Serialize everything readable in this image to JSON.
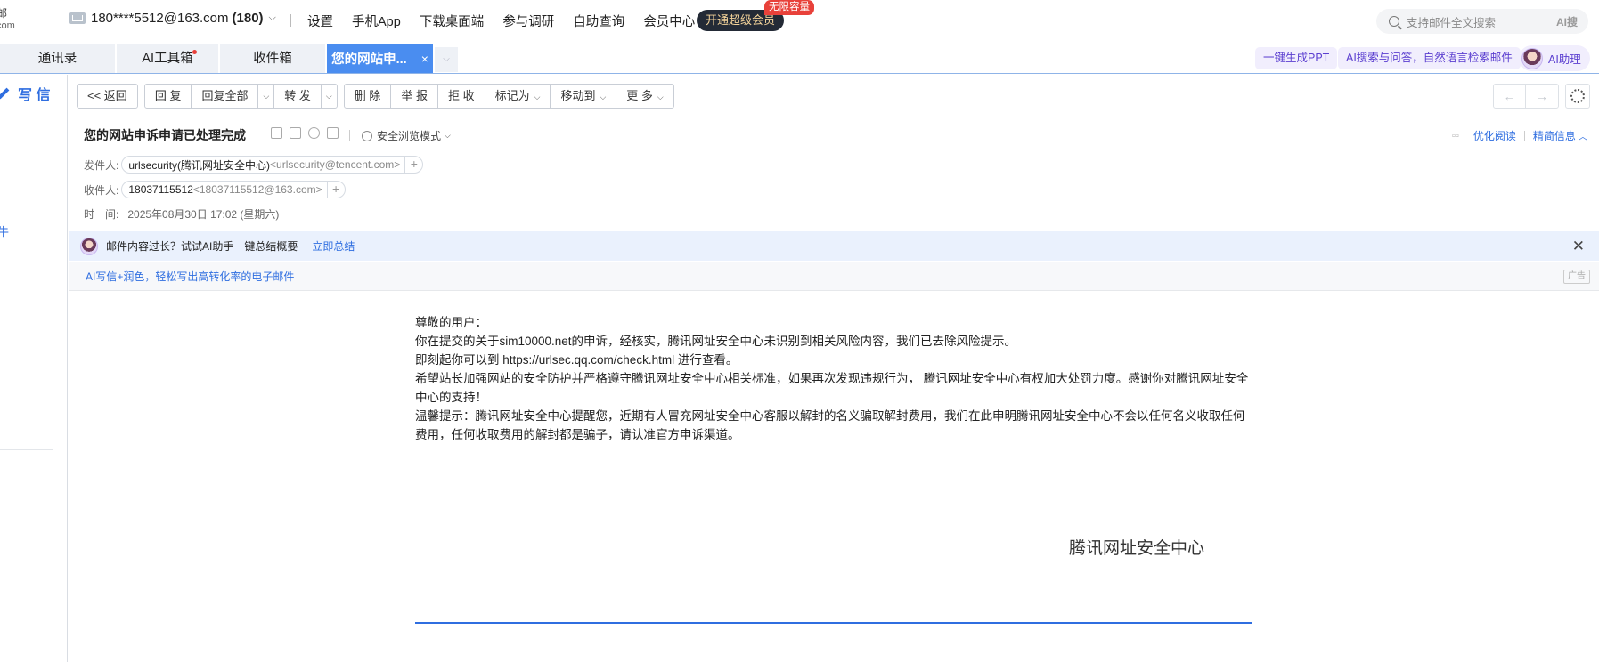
{
  "brand": {
    "title_fragment": "邮",
    "sub_fragment": "com"
  },
  "account": {
    "email": "180****5512@163.com",
    "count": "(180)"
  },
  "top_nav": [
    "设置",
    "手机App",
    "下载桌面端",
    "参与调研",
    "自助查询",
    "会员中心"
  ],
  "vip": {
    "button": "开通超级会员",
    "tag": "无限容量"
  },
  "search": {
    "placeholder": "支持邮件全文搜索",
    "ai_mark": "AI搜"
  },
  "tabs": [
    {
      "label": "通讯录"
    },
    {
      "label": "AI工具箱"
    },
    {
      "label": "收件箱"
    },
    {
      "label": "您的网站申..."
    }
  ],
  "tab_close": "×",
  "tab_more": "⌵",
  "pills": {
    "ppt": "一键生成PPT",
    "ai_search": "AI搜索与问答，自然语言检索邮件",
    "ai_helper": "AI助理"
  },
  "sidebar": {
    "compose": "写 信",
    "fragment": "牛"
  },
  "toolbar": {
    "back": "返回",
    "reply": "回 复",
    "reply_all": "回复全部",
    "forward": "转 发",
    "delete": "删 除",
    "report": "举 报",
    "reject": "拒 收",
    "mark_as": "标记为",
    "move_to": "移动到",
    "more": "更 多"
  },
  "mail": {
    "subject": "您的网站申诉申请已处理完成",
    "safe_mode": "安全浏览模式",
    "optimize": "优化阅读",
    "brief": "精简信息",
    "sender_label": "发件人:",
    "sender_name": "urlsecurity(腾讯网址安全中心)",
    "sender_addr": "<urlsecurity@tencent.com>",
    "recipient_label": "收件人:",
    "recipient_name": "18037115512",
    "recipient_addr": "<18037115512@163.com>",
    "time_label": "时　间:",
    "time_value": "2025年08月30日 17:02 (星期六)"
  },
  "ai_banner": {
    "text": "邮件内容过长？试试AI助手一键总结概要",
    "link": "立即总结"
  },
  "ad_banner": {
    "text": "AI写信+润色，轻松写出高转化率的电子邮件",
    "tag": "广告"
  },
  "body": {
    "lines": [
      "尊敬的用户：",
      "你在提交的关于sim10000.net的申诉，经核实，腾讯网址安全中心未识别到相关风险内容，我们已去除风险提示。",
      "即刻起你可以到 https://urlsec.qq.com/check.html 进行查看。",
      "希望站长加强网站的安全防护并严格遵守腾讯网址安全中心相关标准，如果再次发现违规行为， 腾讯网址安全中心有权加大处罚力度。感谢你对腾讯网址安全中心的支持！",
      "温馨提示：腾讯网址安全中心提醒您，近期有人冒充网址安全中心客服以解封的名义骗取解封费用，我们在此申明腾讯网址安全中心不会以任何名义收取任何费用，任何收取费用的解封都是骗子，请认准官方申诉渠道。"
    ],
    "signature": "腾讯网址安全中心"
  },
  "colors": {
    "accent": "#2f6ee0",
    "active_tab": "#4a8df0",
    "vip_bg": "#232a36",
    "tag_red": "#e8413a"
  }
}
